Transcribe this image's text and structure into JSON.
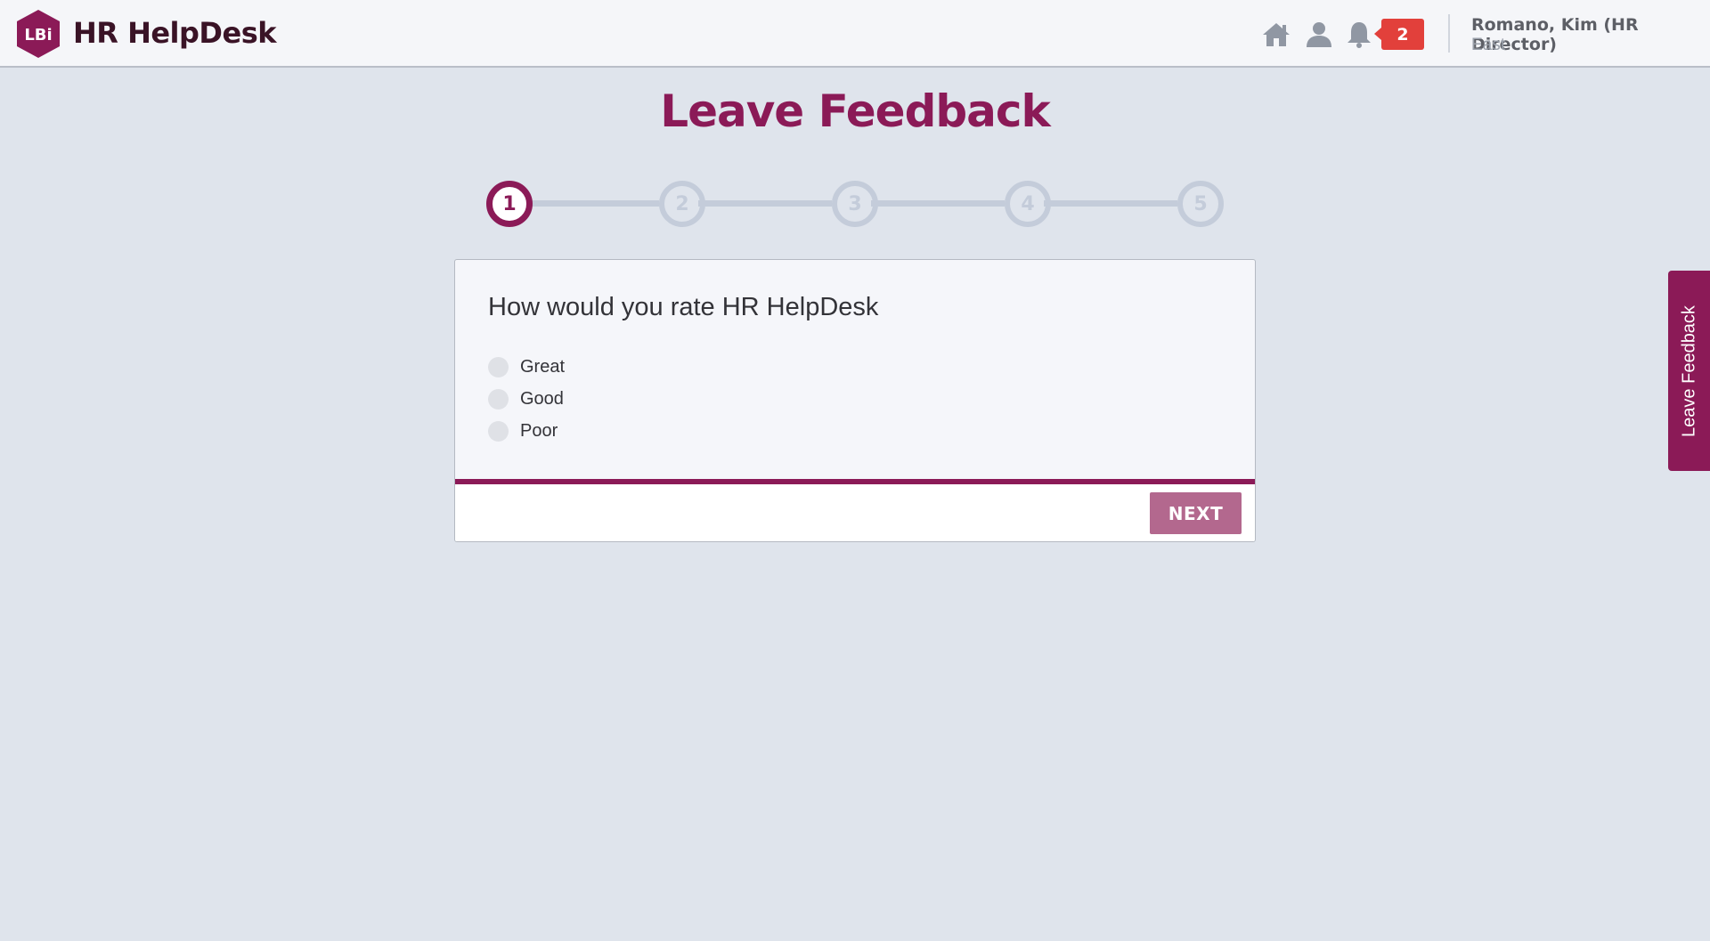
{
  "header": {
    "brand": "HR HelpDesk",
    "logo_text": "LBi",
    "notification_count": "2",
    "user": {
      "name": "Romano, Kim (HR Director)",
      "region": "East"
    },
    "icons": [
      "home-icon",
      "user-icon",
      "bell-icon"
    ]
  },
  "page": {
    "title": "Leave Feedback"
  },
  "stepper": {
    "current_step": 1,
    "steps": [
      "1",
      "2",
      "3",
      "4",
      "5"
    ]
  },
  "question": {
    "text": "How would you rate HR HelpDesk",
    "options": [
      "Great",
      "Good",
      "Poor"
    ]
  },
  "actions": {
    "next_label": "NEXT"
  },
  "side_tab": {
    "label": "Leave Feedback"
  },
  "colors": {
    "brand": "#8b1a57",
    "background": "#dfe4ec",
    "badge": "#e2403b",
    "next_button": "#b3688e",
    "stepper_inactive": "#c4ccda"
  }
}
